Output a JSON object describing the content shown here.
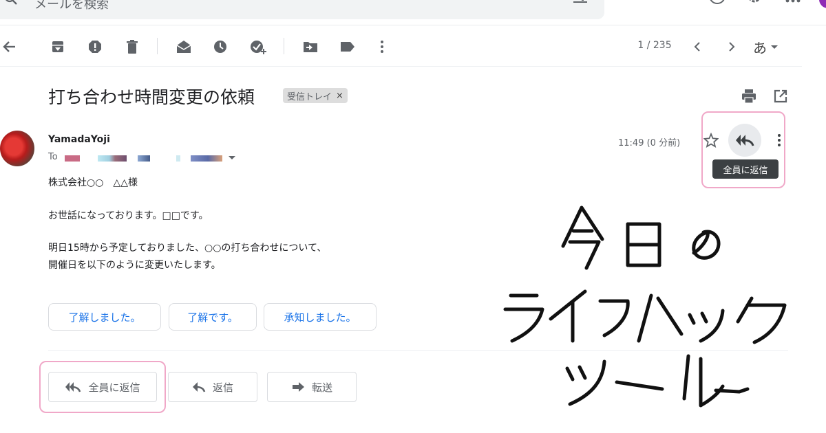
{
  "search": {
    "placeholder": "メールを検索"
  },
  "toolbar": {
    "counter": "1 / 235",
    "lang": "あ"
  },
  "email": {
    "subject": "打ち合わせ時間変更の依頼",
    "label": "受信トレイ",
    "label_close": "×",
    "sender": "YamadaYoji",
    "to_prefix": "To",
    "time": "11:49 (0 分前)",
    "body": [
      "株式会社○○　△△様",
      "お世話になっております。□□です。",
      "明日15時から予定しておりました、○○の打ち合わせについて、",
      "開催日を以下のように変更いたします。"
    ]
  },
  "tooltip": "全員に返信",
  "smart_replies": [
    "了解しました。",
    "了解です。",
    "承知しました。"
  ],
  "actions": {
    "reply_all": "全員に返信",
    "reply": "返信",
    "forward": "転送"
  },
  "handwriting": {
    "lines": [
      "今日の",
      "ライフハック",
      "ツール"
    ]
  },
  "colors": {
    "highlight": "#f0a8c8",
    "link": "#1a73e8"
  }
}
